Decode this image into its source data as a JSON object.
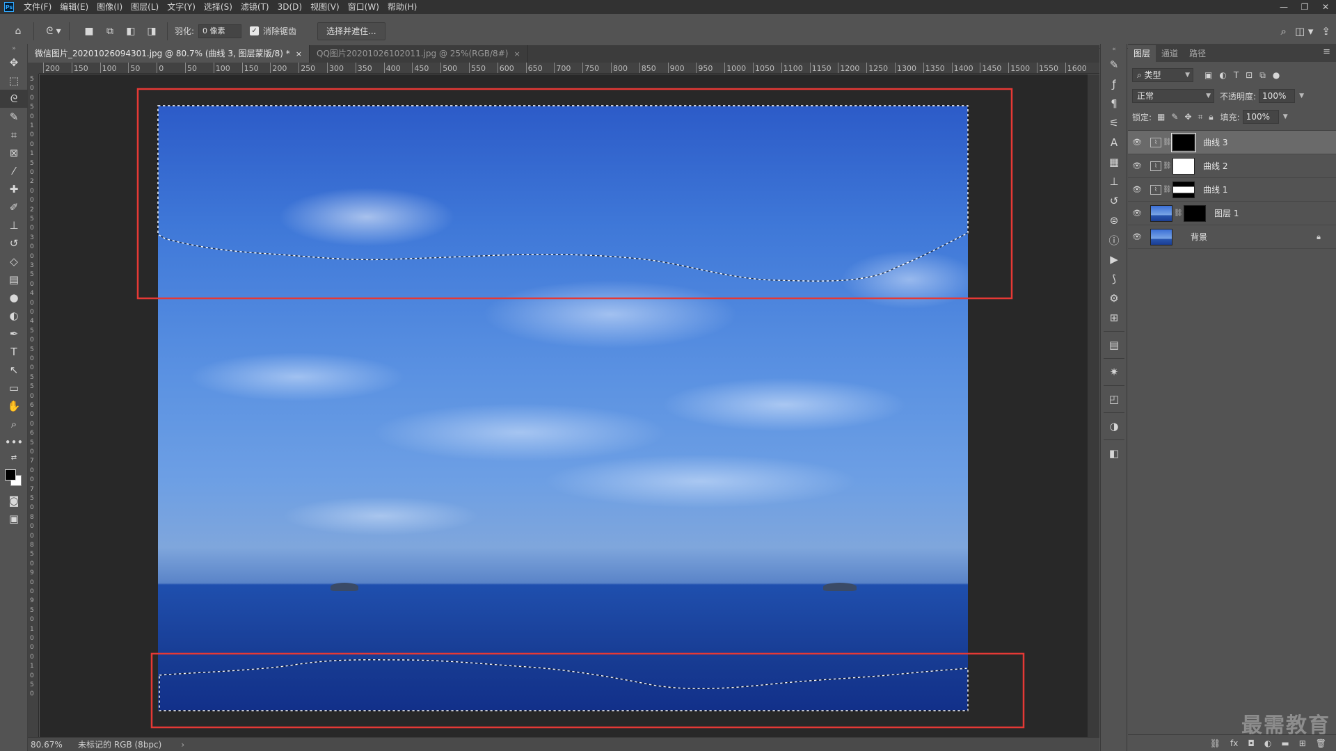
{
  "menu": {
    "logo": "Ps",
    "items": [
      "文件(F)",
      "编辑(E)",
      "图像(I)",
      "图层(L)",
      "文字(Y)",
      "选择(S)",
      "滤镜(T)",
      "3D(D)",
      "视图(V)",
      "窗口(W)",
      "帮助(H)"
    ],
    "window_controls": [
      "—",
      "❐",
      "✕"
    ]
  },
  "options": {
    "feather_label": "羽化:",
    "feather_value": "0 像素",
    "antialias_label": "消除锯齿",
    "antialias_checked": true,
    "select_mask_button": "选择并遮住..."
  },
  "tabs": [
    {
      "label": "微信图片_20201026094301.jpg @ 80.7% (曲线 3, 图层蒙版/8) *",
      "close": "×",
      "active": true
    },
    {
      "label": "QQ图片20201026102011.jpg @ 25%(RGB/8#)",
      "close": "×",
      "active": false
    }
  ],
  "ruler": {
    "h_ticks": [
      "200",
      "150",
      "100",
      "50",
      "0",
      "50",
      "100",
      "150",
      "200",
      "250",
      "300",
      "350",
      "400",
      "450",
      "500",
      "550",
      "600",
      "650",
      "700",
      "750",
      "800",
      "850",
      "900",
      "950",
      "1000",
      "1050",
      "1100",
      "1150",
      "1200",
      "1250",
      "1300",
      "1350",
      "1400",
      "1450",
      "1500",
      "1550",
      "1600"
    ],
    "v_ticks": [
      "5",
      "0",
      "0",
      "5",
      "0",
      "1",
      "0",
      "0",
      "1",
      "5",
      "0",
      "2",
      "0",
      "0",
      "2",
      "5",
      "0",
      "3",
      "0",
      "0",
      "3",
      "5",
      "0",
      "4",
      "0",
      "0",
      "4",
      "5",
      "0",
      "5",
      "0",
      "0",
      "5",
      "5",
      "0",
      "6",
      "0",
      "0",
      "6",
      "5",
      "0",
      "7",
      "0",
      "0",
      "7",
      "5",
      "0",
      "8",
      "0",
      "0",
      "8",
      "5",
      "0",
      "9",
      "0",
      "0",
      "9",
      "5",
      "0",
      "1",
      "0",
      "0",
      "0",
      "1",
      "0",
      "5",
      "0"
    ]
  },
  "status": {
    "zoom": "80.67%",
    "info": "未标记的 RGB (8bpc)",
    "arrow": "›"
  },
  "layers_panel": {
    "tabs": [
      "图层",
      "通道",
      "路径"
    ],
    "filter_kind": "类型",
    "blend_mode": "正常",
    "opacity_label": "不透明度:",
    "opacity_value": "100%",
    "lock_label": "锁定:",
    "fill_label": "填充:",
    "fill_value": "100%",
    "layers": [
      {
        "name": "曲线 3",
        "type": "curves",
        "mask": "black",
        "selected": true
      },
      {
        "name": "曲线 2",
        "type": "curves",
        "mask": "white",
        "selected": false
      },
      {
        "name": "曲线 1",
        "type": "curves",
        "mask": "mixed",
        "selected": false
      },
      {
        "name": "图层 1",
        "type": "pixel",
        "mask": "black",
        "selected": false
      },
      {
        "name": "背景",
        "type": "background",
        "locked": true,
        "selected": false
      }
    ]
  },
  "watermark": "最需教育",
  "colors": {
    "highlight_box": "#e53935",
    "foreground": "#000000",
    "background": "#ffffff"
  }
}
